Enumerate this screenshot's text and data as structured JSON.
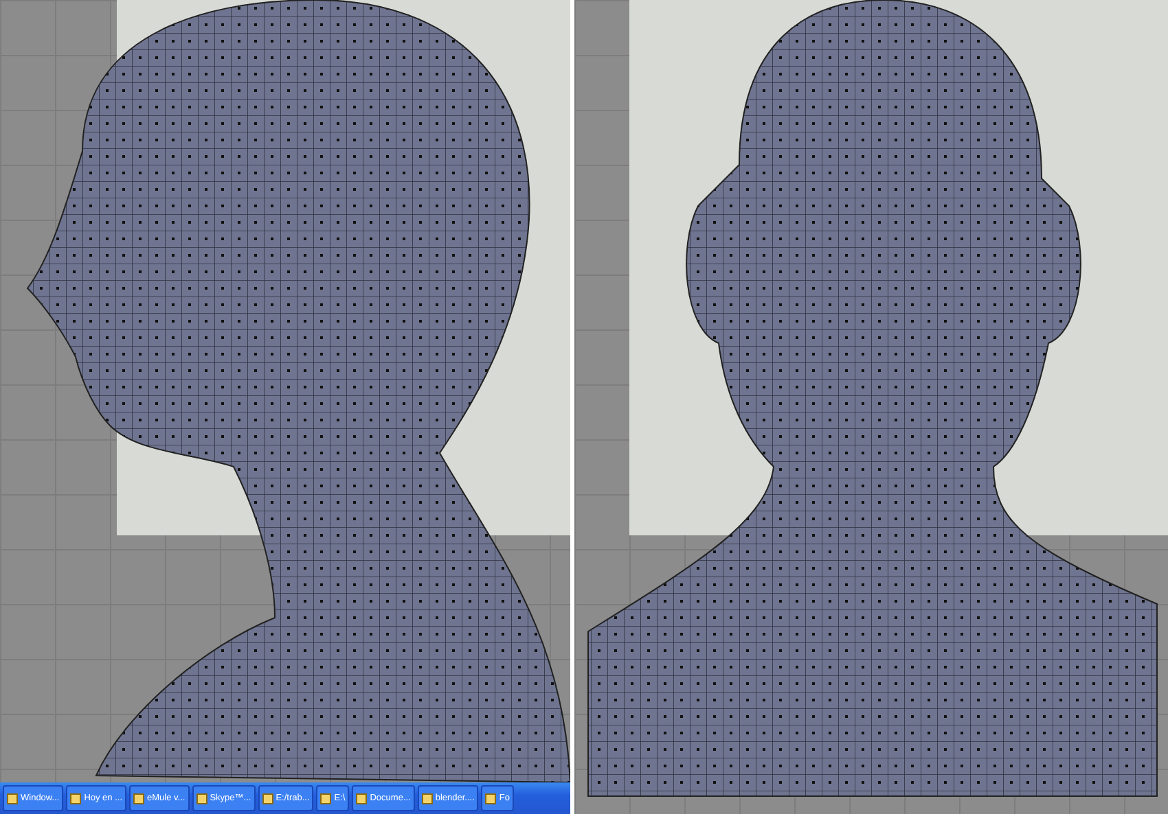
{
  "viewports": [
    {
      "kind": "side"
    },
    {
      "kind": "front"
    }
  ],
  "taskbar": {
    "buttons": [
      {
        "label": "Window..."
      },
      {
        "label": "Hoy en ..."
      },
      {
        "label": "eMule v..."
      },
      {
        "label": "Skype™..."
      },
      {
        "label": "E:/trab..."
      },
      {
        "label": "E:\\"
      },
      {
        "label": "Docume..."
      },
      {
        "label": "blender...."
      },
      {
        "label": "Fo"
      }
    ]
  }
}
